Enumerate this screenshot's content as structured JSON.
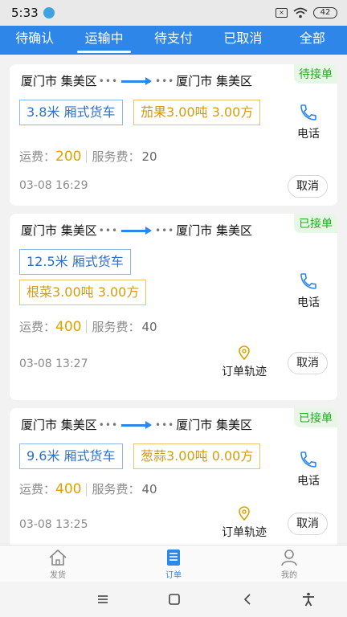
{
  "status_bar": {
    "time": "5:33",
    "battery": "42"
  },
  "tabs": [
    {
      "label": "待确认"
    },
    {
      "label": "运输中",
      "active": true
    },
    {
      "label": "待支付"
    },
    {
      "label": "已取消"
    },
    {
      "label": "全部"
    }
  ],
  "orders": [
    {
      "origin": "厦门市 集美区",
      "destination": "厦门市 集美区",
      "status": "待接单",
      "truck": "3.8米 厢式货车",
      "goods": "茄果3.00吨  3.00方",
      "fee_label": "运费：",
      "fee": "200",
      "service_label": "服务费：",
      "service_fee": "20",
      "datetime": "03-08 16:29",
      "call_label": "电话",
      "cancel_label": "取消"
    },
    {
      "origin": "厦门市 集美区",
      "destination": "厦门市 集美区",
      "status": "已接单",
      "truck": "12.5米 厢式货车",
      "goods": "根菜3.00吨  3.00方",
      "fee_label": "运费：",
      "fee": "400",
      "service_label": "服务费：",
      "service_fee": "40",
      "datetime": "03-08 13:27",
      "call_label": "电话",
      "track_label": "订单轨迹",
      "cancel_label": "取消"
    },
    {
      "origin": "厦门市 集美区",
      "destination": "厦门市 集美区",
      "status": "已接单",
      "truck": "9.6米 厢式货车",
      "goods": "葱蒜3.00吨  0.00方",
      "fee_label": "运费：",
      "fee": "400",
      "service_label": "服务费：",
      "service_fee": "40",
      "datetime": "03-08 13:25",
      "call_label": "电话",
      "track_label": "订单轨迹",
      "cancel_label": "取消"
    }
  ],
  "bottom_nav": [
    {
      "label": "发货",
      "icon": "home-icon"
    },
    {
      "label": "订单",
      "icon": "order-icon",
      "active": true
    },
    {
      "label": "我的",
      "icon": "user-icon"
    }
  ],
  "colors": {
    "primary": "#2f86e9",
    "fee": "#e0a000",
    "status_green": "#2aa52a",
    "goods_border": "#e9c46a"
  }
}
